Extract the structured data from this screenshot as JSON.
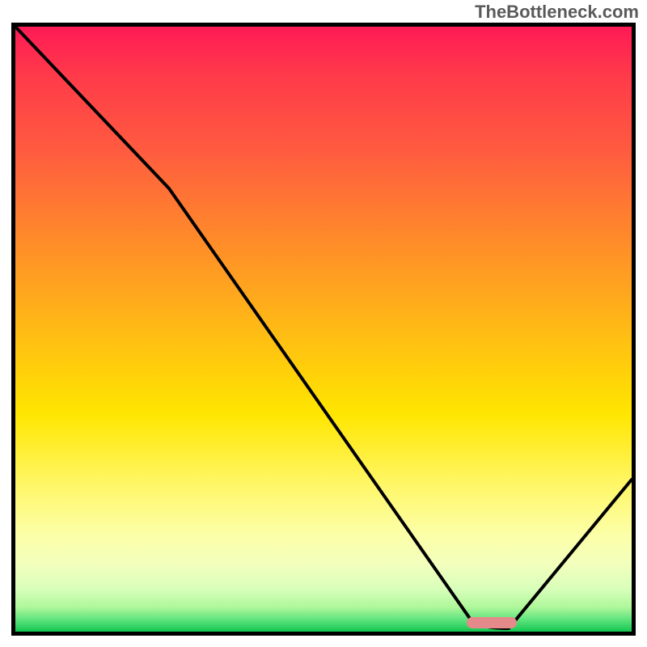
{
  "attribution": "TheBottleneck.com",
  "chart_data": {
    "type": "line",
    "title": "",
    "xlabel": "",
    "ylabel": "",
    "xlim": [
      0,
      100
    ],
    "ylim": [
      0,
      100
    ],
    "x": [
      0,
      25,
      74,
      80,
      100
    ],
    "values": [
      100,
      73,
      1,
      0.5,
      25
    ],
    "optimal_range_x": [
      73,
      81
    ],
    "optimal_y": 0.5
  },
  "colors": {
    "border": "#000000",
    "curve": "#000000",
    "marker": "#e58a8a",
    "gradient_top": "#ff1a55",
    "gradient_bottom": "#13c652"
  }
}
